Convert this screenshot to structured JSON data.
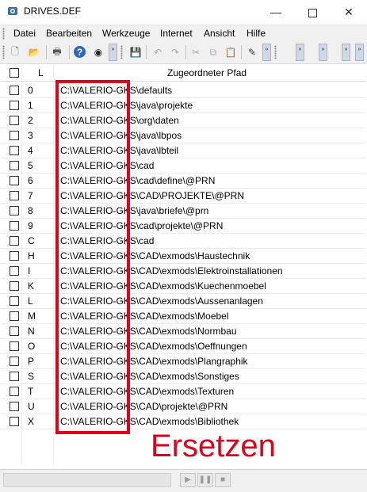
{
  "window": {
    "title": "DRIVES.DEF",
    "minimize_label": "—",
    "maximize_label": "",
    "close_label": "✕"
  },
  "menu": [
    "Datei",
    "Bearbeiten",
    "Werkzeuge",
    "Internet",
    "Ansicht",
    "Hilfe"
  ],
  "toolbar": {
    "buttons": [
      "new-file-icon",
      "open-folder-icon",
      "print-icon",
      "help-icon",
      "preview-icon",
      "save-icon",
      "undo-icon",
      "redo-icon",
      "cut-icon",
      "copy-icon",
      "paste-icon",
      "edit-icon"
    ],
    "glyphs": [
      "🗋",
      "📂",
      "🖶",
      "?",
      "◉",
      "💾",
      "↶",
      "↷",
      "✂",
      "⧉",
      "📋",
      "✎"
    ],
    "overflow_label": "»"
  },
  "table": {
    "headers": {
      "check": "",
      "l": "L",
      "path": "Zugeordneter Pfad"
    },
    "rows": [
      {
        "l": "0",
        "path": "C:\\VALERIO-GKS\\defaults"
      },
      {
        "l": "1",
        "path": "C:\\VALERIO-GKS\\java\\projekte"
      },
      {
        "l": "2",
        "path": "C:\\VALERIO-GKS\\org\\daten"
      },
      {
        "l": "3",
        "path": "C:\\VALERIO-GKS\\java\\lbpos"
      },
      {
        "l": "4",
        "path": "C:\\VALERIO-GKS\\java\\lbteil"
      },
      {
        "l": "5",
        "path": "C:\\VALERIO-GKS\\cad"
      },
      {
        "l": "6",
        "path": "C:\\VALERIO-GKS\\cad\\define\\@PRN"
      },
      {
        "l": "7",
        "path": "C:\\VALERIO-GKS\\CAD\\PROJEKTE\\@PRN"
      },
      {
        "l": "8",
        "path": "C:\\VALERIO-GKS\\java\\briefe\\@prn"
      },
      {
        "l": "9",
        "path": "C:\\VALERIO-GKS\\cad\\projekte\\@PRN"
      },
      {
        "l": "C",
        "path": "C:\\VALERIO-GKS\\cad"
      },
      {
        "l": "H",
        "path": "C:\\VALERIO-GKS\\CAD\\exmods\\Haustechnik"
      },
      {
        "l": "I",
        "path": "C:\\VALERIO-GKS\\CAD\\exmods\\Elektroinstallationen"
      },
      {
        "l": "K",
        "path": "C:\\VALERIO-GKS\\CAD\\exmods\\Kuechenmoebel"
      },
      {
        "l": "L",
        "path": "C:\\VALERIO-GKS\\CAD\\exmods\\Aussenanlagen"
      },
      {
        "l": "M",
        "path": "C:\\VALERIO-GKS\\CAD\\exmods\\Moebel"
      },
      {
        "l": "N",
        "path": "C:\\VALERIO-GKS\\CAD\\exmods\\Normbau"
      },
      {
        "l": "O",
        "path": "C:\\VALERIO-GKS\\CAD\\exmods\\Oeffnungen"
      },
      {
        "l": "P",
        "path": "C:\\VALERIO-GKS\\CAD\\exmods\\Plangraphik"
      },
      {
        "l": "S",
        "path": "C:\\VALERIO-GKS\\CAD\\exmods\\Sonstiges"
      },
      {
        "l": "T",
        "path": "C:\\VALERIO-GKS\\CAD\\exmods\\Texturen"
      },
      {
        "l": "U",
        "path": "C:\\VALERIO-GKS\\CAD\\projekte\\@PRN"
      },
      {
        "l": "X",
        "path": "C:\\VALERIO-GKS\\CAD\\exmods\\Bibliothek"
      }
    ]
  },
  "annotation": {
    "text": "Ersetzen",
    "color": "#e0001b"
  },
  "statusbar": {
    "controls": [
      "play-icon",
      "pause-icon",
      "stop-icon"
    ],
    "glyphs": [
      "▶",
      "❚❚",
      "■"
    ]
  },
  "colors": {
    "accent_red": "#e0001b",
    "chrome": "#f0f0f0"
  }
}
